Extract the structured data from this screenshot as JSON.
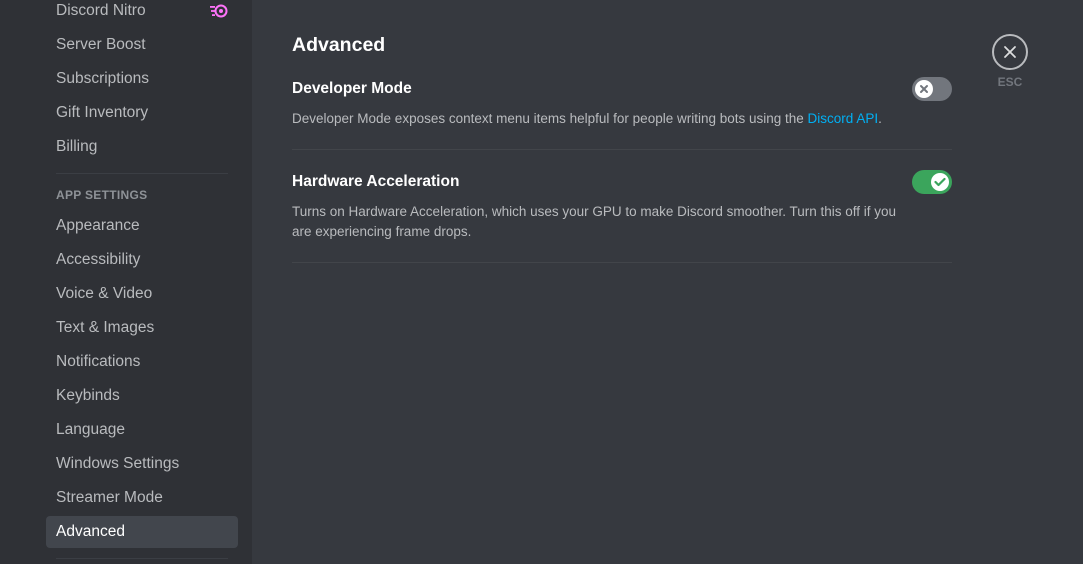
{
  "sidebar": {
    "top_items": [
      {
        "label": "Discord Nitro",
        "name": "sidebar-item-discord-nitro"
      },
      {
        "label": "Server Boost",
        "name": "sidebar-item-server-boost"
      },
      {
        "label": "Subscriptions",
        "name": "sidebar-item-subscriptions"
      },
      {
        "label": "Gift Inventory",
        "name": "sidebar-item-gift-inventory"
      },
      {
        "label": "Billing",
        "name": "sidebar-item-billing"
      }
    ],
    "app_settings_header": "APP SETTINGS",
    "app_items": [
      {
        "label": "Appearance"
      },
      {
        "label": "Accessibility"
      },
      {
        "label": "Voice & Video"
      },
      {
        "label": "Text & Images"
      },
      {
        "label": "Notifications"
      },
      {
        "label": "Keybinds"
      },
      {
        "label": "Language"
      },
      {
        "label": "Windows Settings"
      },
      {
        "label": "Streamer Mode"
      },
      {
        "label": "Advanced"
      }
    ],
    "selected": "Advanced"
  },
  "main": {
    "title": "Advanced",
    "settings": [
      {
        "title": "Developer Mode",
        "description_prefix": "Developer Mode exposes context menu items helpful for people writing bots using the ",
        "description_link": "Discord API",
        "description_suffix": ".",
        "enabled": false
      },
      {
        "title": "Hardware Acceleration",
        "description": "Turns on Hardware Acceleration, which uses your GPU to make Discord smoother. Turn this off if you are experiencing frame drops.",
        "enabled": true
      }
    ]
  },
  "close": {
    "label": "ESC",
    "icon": "close-icon"
  },
  "icons": {
    "nitro_badge": "nitro-icon",
    "toggle_off": "x-icon",
    "toggle_on": "check-icon"
  },
  "colors": {
    "sidebar_bg": "#2f3136",
    "content_bg": "#36393f",
    "selected_bg": "#42464d",
    "toggle_on": "#3ba55c",
    "toggle_off": "#72767d",
    "link": "#00b0f4",
    "nitro_accent": "#ff73fa"
  }
}
